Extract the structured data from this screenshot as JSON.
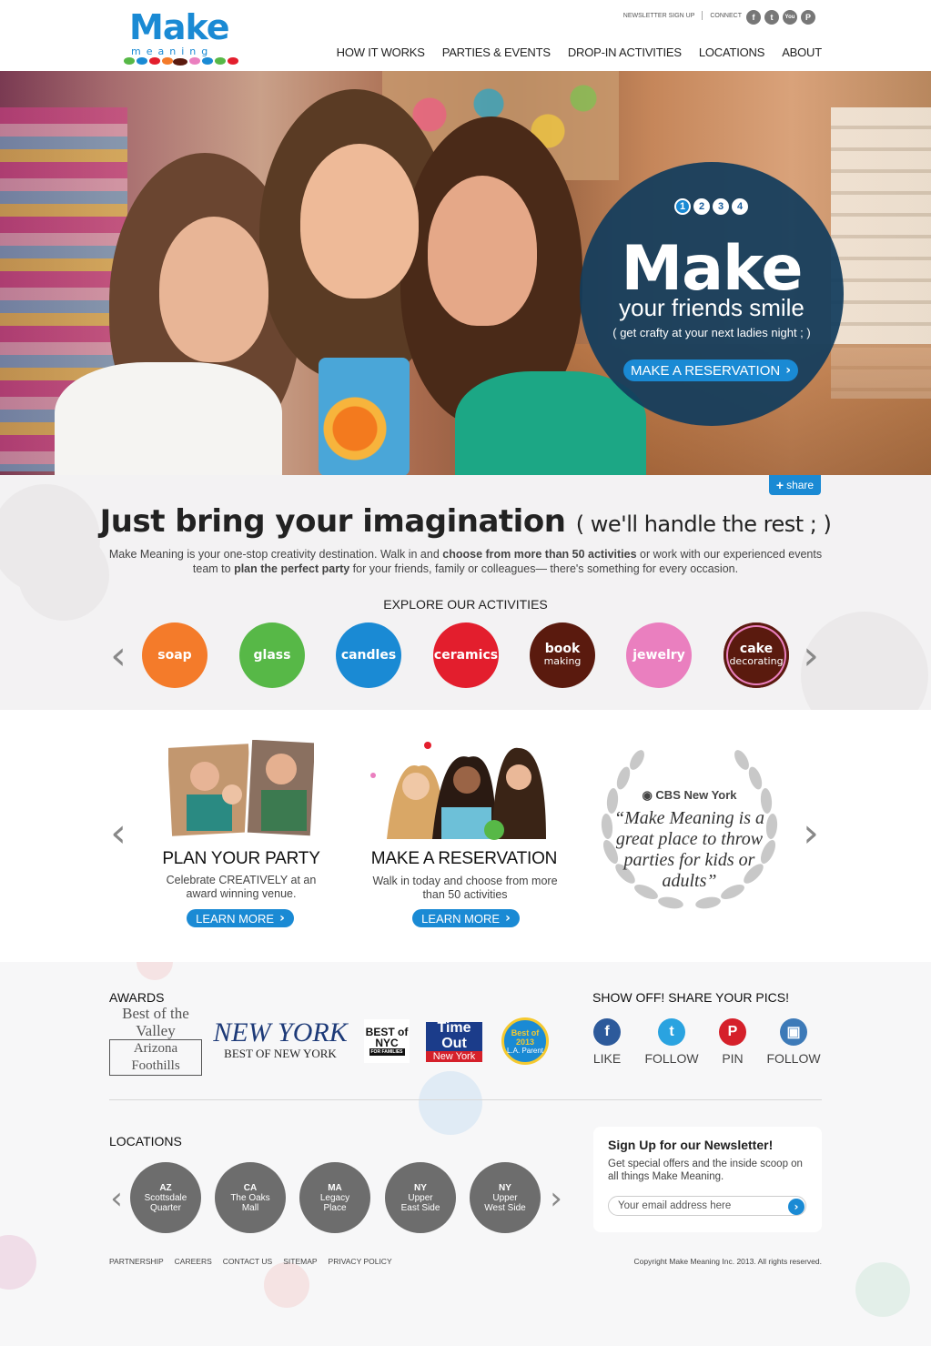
{
  "header": {
    "logo_make": "Make",
    "logo_meaning": "meaning",
    "newsletter_link": "NEWSLETTER SIGN UP",
    "connect_label": "CONNECT",
    "social": [
      {
        "icon": "facebook-icon",
        "glyph": "f"
      },
      {
        "icon": "twitter-icon",
        "glyph": "t"
      },
      {
        "icon": "youtube-icon",
        "glyph": "You"
      },
      {
        "icon": "pinterest-icon",
        "glyph": "P"
      }
    ],
    "nav": [
      "HOW IT WORKS",
      "PARTIES & EVENTS",
      "DROP-IN ACTIVITIES",
      "LOCATIONS",
      "ABOUT"
    ]
  },
  "hero": {
    "slides": [
      "1",
      "2",
      "3",
      "4"
    ],
    "active_slide": 1,
    "title": "Make",
    "subtitle": "your friends smile",
    "tagline": "( get crafty at your next ladies night ; )",
    "cta": "MAKE A RESERVATION"
  },
  "intro": {
    "share_label": "share",
    "title_bold": "Just bring your imagination",
    "title_light": "( we'll handle the rest  ; )",
    "text_1": "Make Meaning is your one-stop creativity destination. Walk in and ",
    "text_bold_1": "choose from more than 50 activities",
    "text_2": " or work with our experienced events team to ",
    "text_bold_2": "plan the perfect party",
    "text_3": " for your friends, family or colleagues— there's something for every occasion.",
    "explore_label": "EXPLORE OUR ACTIVITIES",
    "activities": [
      {
        "name": "soap",
        "sub": "",
        "color": "#f47b2a"
      },
      {
        "name": "glass",
        "sub": "",
        "color": "#57b847"
      },
      {
        "name": "candles",
        "sub": "",
        "color": "#1a8ad4"
      },
      {
        "name": "ceramics",
        "sub": "",
        "color": "#e31e2d"
      },
      {
        "name": "book",
        "sub": "making",
        "color": "#5a1a0e"
      },
      {
        "name": "jewelry",
        "sub": "",
        "color": "#ea7fbf"
      },
      {
        "name": "cake",
        "sub": "decorating",
        "color": "#5a1a0e"
      }
    ]
  },
  "features": {
    "party_title": "PLAN YOUR PARTY",
    "party_text": "Celebrate CREATIVELY at an award winning venue.",
    "party_btn": "LEARN MORE",
    "reserve_title": "MAKE A RESERVATION",
    "reserve_text": "Walk in today and choose from more than 50 activities",
    "reserve_btn": "LEARN MORE",
    "quote_source": "CBS New York",
    "quote": "“Make Meaning is a great place to throw parties for kids or adults”"
  },
  "awards": {
    "heading": "AWARDS",
    "items": [
      {
        "line1": "Best of the Valley",
        "line2": "Arizona Foothills"
      },
      {
        "line1": "NEW YORK",
        "line2": "BEST OF NEW YORK"
      },
      {
        "line1": "BEST of NYC",
        "line2": "FOR FAMILIES"
      },
      {
        "line1": "Time Out",
        "line2": "New York"
      },
      {
        "line1": "Best of 2013",
        "line2": "L.A. Parent"
      }
    ]
  },
  "share_pics": {
    "heading": "SHOW OFF! SHARE YOUR PICS!",
    "items": [
      {
        "label": "LIKE",
        "icon": "facebook-icon",
        "glyph": "f",
        "color": "#2d5a9b"
      },
      {
        "label": "FOLLOW",
        "icon": "twitter-icon",
        "glyph": "t",
        "color": "#2aa3e0"
      },
      {
        "label": "PIN",
        "icon": "pinterest-icon",
        "glyph": "P",
        "color": "#d5202a"
      },
      {
        "label": "FOLLOW",
        "icon": "instagram-icon",
        "glyph": "▣",
        "color": "#3d7ab8"
      }
    ]
  },
  "locations": {
    "heading": "LOCATIONS",
    "items": [
      {
        "state": "AZ",
        "line1": "Scottsdale",
        "line2": "Quarter"
      },
      {
        "state": "CA",
        "line1": "The Oaks",
        "line2": "Mall"
      },
      {
        "state": "MA",
        "line1": "Legacy",
        "line2": "Place"
      },
      {
        "state": "NY",
        "line1": "Upper",
        "line2": "East Side"
      },
      {
        "state": "NY",
        "line1": "Upper",
        "line2": "West Side"
      }
    ]
  },
  "newsletter": {
    "title": "Sign Up for our Newsletter!",
    "text": "Get special offers and the inside scoop on all things Make Meaning.",
    "placeholder": "Your email address here"
  },
  "footer": {
    "links": [
      "PARTNERSHIP",
      "CAREERS",
      "CONTACT US",
      "SITEMAP",
      "PRIVACY POLICY"
    ],
    "copyright": "Copyright Make Meaning Inc. 2013. All rights reserved."
  }
}
